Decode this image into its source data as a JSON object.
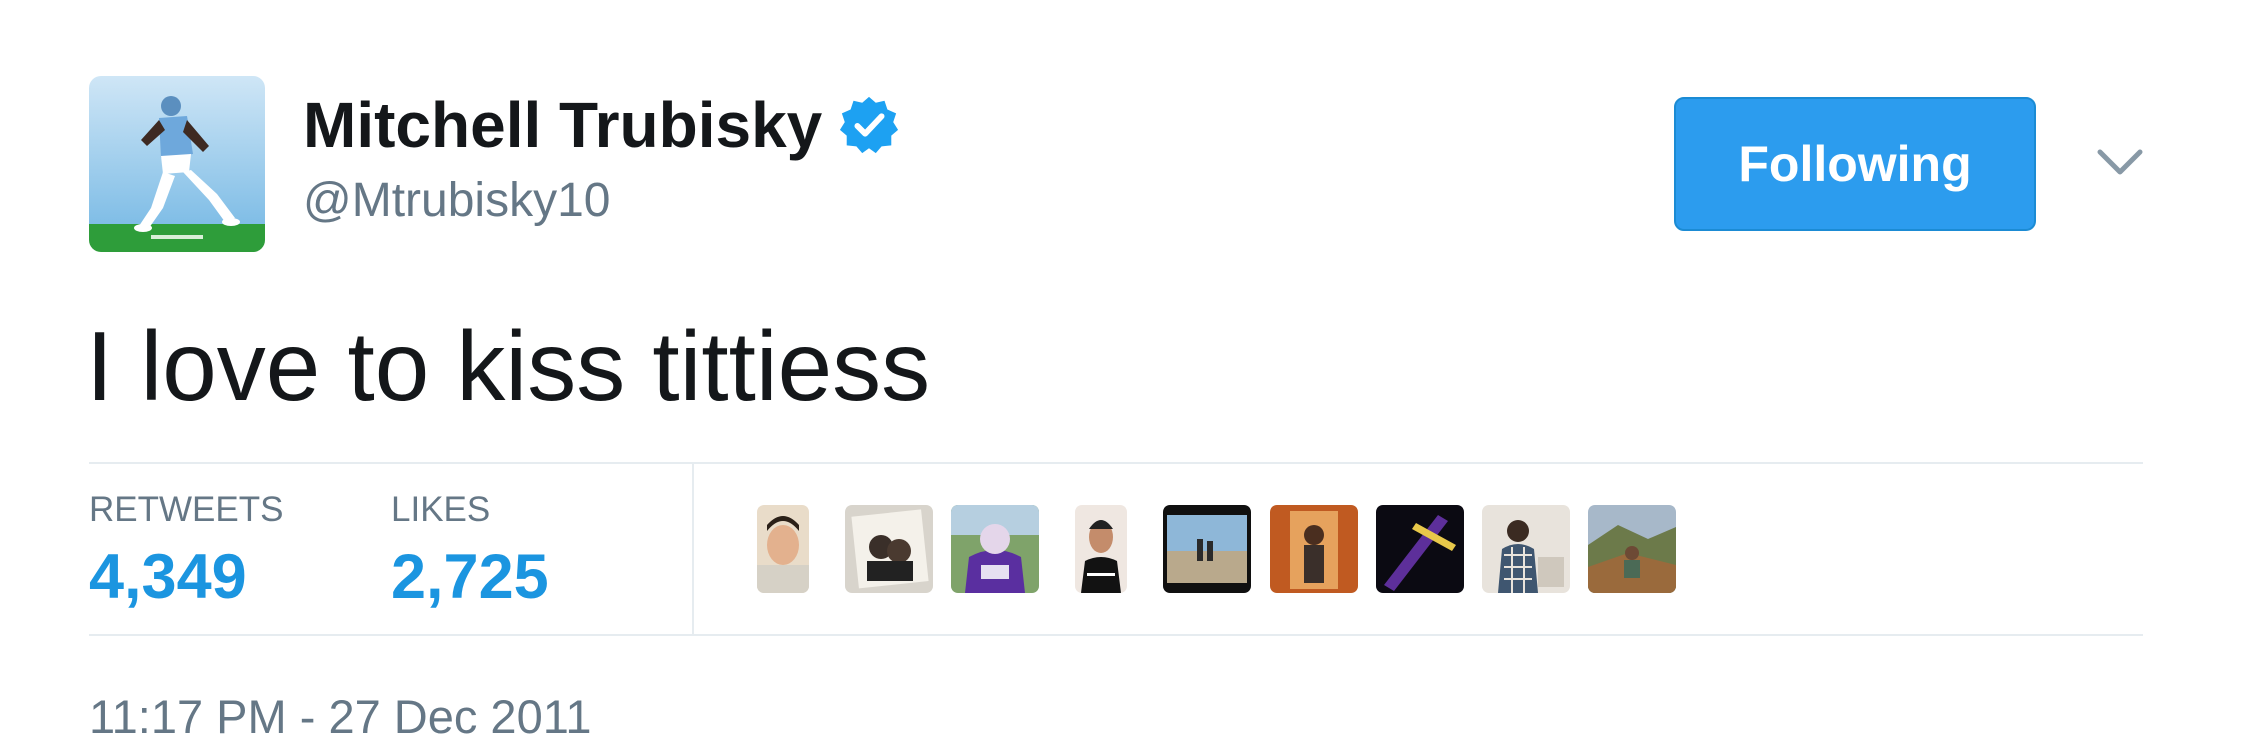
{
  "user": {
    "name": "Mitchell Trubisky",
    "handle": "@Mtrubisky10",
    "avatar_icon": "football-player-avatar",
    "verified_icon": "verified-badge-icon"
  },
  "follow_button": {
    "label": "Following"
  },
  "menu": {
    "icon": "chevron-down-icon"
  },
  "tweet": {
    "text": "I love to kiss tittiess"
  },
  "stats": {
    "retweets_label": "RETWEETS",
    "retweets_value": "4,349",
    "likes_label": "LIKES",
    "likes_value": "2,725"
  },
  "timestamp": "11:17 PM - 27 Dec 2011",
  "colors": {
    "follow_button_bg": "#2c9cee",
    "stat_value": "#1b95e0",
    "secondary_text": "#657786",
    "primary_text": "#14171a",
    "verified_badge": "#1da1f2"
  }
}
